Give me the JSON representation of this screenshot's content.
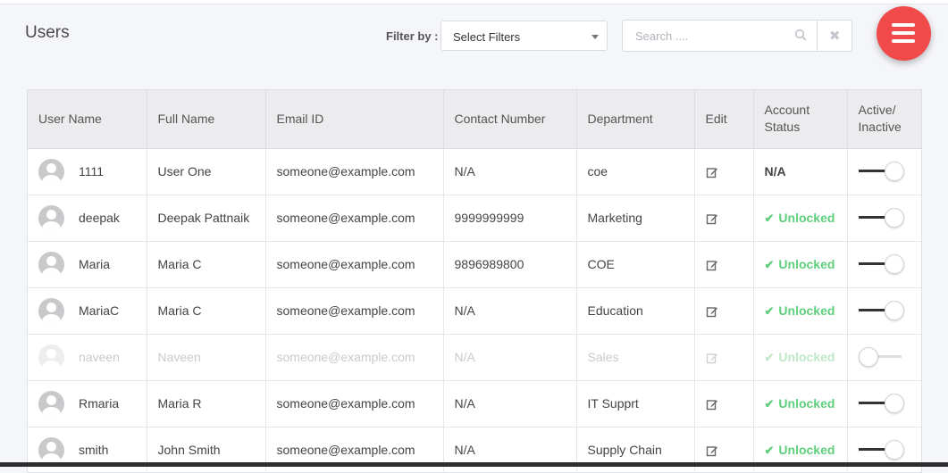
{
  "page": {
    "title": "Users",
    "filter_label": "Filter by :",
    "filter_value": "Select Filters",
    "search_placeholder": "Search ....",
    "clear_symbol": "✖"
  },
  "icons": {
    "menu": "hamburger-menu-icon",
    "search": "search-icon",
    "clear": "close-icon",
    "edit": "edit-icon",
    "check": "check-icon",
    "avatar": "user-avatar-icon"
  },
  "colors": {
    "accent_fab": "#f04a4a",
    "unlocked_green": "#5fcf7c",
    "header_bg": "#ececef"
  },
  "table": {
    "columns": [
      "User Name",
      "Full Name",
      "Email ID",
      "Contact Number",
      "Department",
      "Edit",
      "Account Status",
      "Active/ Inactive"
    ],
    "rows": [
      {
        "username": "1111",
        "fullname": "User One",
        "email": "someone@example.com",
        "contact": "N/A",
        "department": "coe",
        "status": "N/A",
        "active": true
      },
      {
        "username": "deepak",
        "fullname": "Deepak Pattnaik",
        "email": "someone@example.com",
        "contact": "9999999999",
        "department": "Marketing",
        "status": "Unlocked",
        "active": true
      },
      {
        "username": "Maria",
        "fullname": "Maria C",
        "email": "someone@example.com",
        "contact": "9896989800",
        "department": "COE",
        "status": "Unlocked",
        "active": true
      },
      {
        "username": "MariaC",
        "fullname": "Maria C",
        "email": "someone@example.com",
        "contact": "N/A",
        "department": "Education",
        "status": "Unlocked",
        "active": true
      },
      {
        "username": "naveen",
        "fullname": "Naveen",
        "email": "someone@example.com",
        "contact": "N/A",
        "department": "Sales",
        "status": "Unlocked",
        "active": false
      },
      {
        "username": "Rmaria",
        "fullname": "Maria R",
        "email": "someone@example.com",
        "contact": "N/A",
        "department": "IT Supprt",
        "status": "Unlocked",
        "active": true
      },
      {
        "username": "smith",
        "fullname": "John Smith",
        "email": "someone@example.com",
        "contact": "N/A",
        "department": "Supply Chain",
        "status": "Unlocked",
        "active": true
      }
    ]
  }
}
